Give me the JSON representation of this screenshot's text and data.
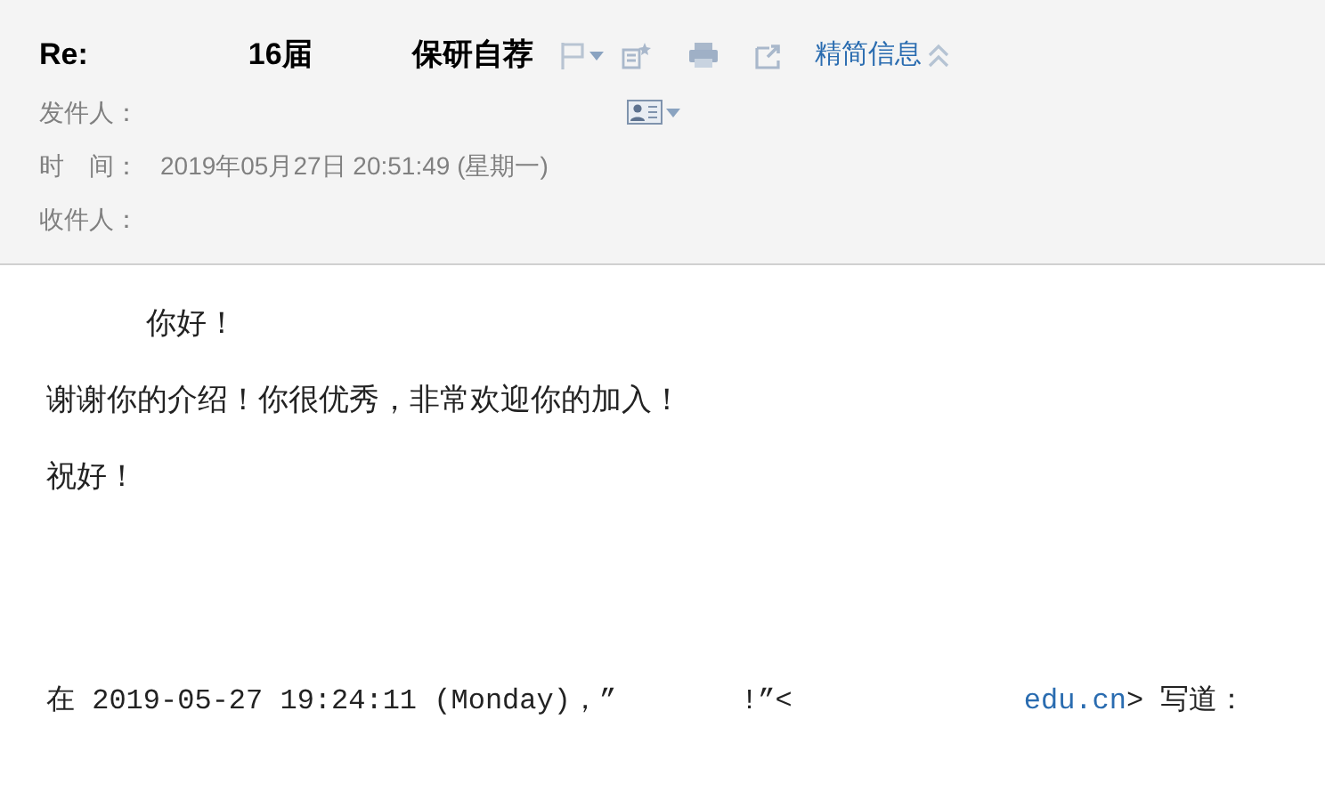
{
  "subject": {
    "parts": [
      "Re:",
      "16届",
      "保研自荐"
    ]
  },
  "toolbar": {
    "toggle_label": "精简信息"
  },
  "fields": [
    {
      "label": "发件人：",
      "kind": "sender"
    },
    {
      "label": "时　间：",
      "kind": "text",
      "value": "2019年05月27日 20:51:49 (星期一)"
    },
    {
      "label": "收件人：",
      "kind": "recipient"
    }
  ],
  "body": [
    {
      "kind": "greeting",
      "text": "你好！"
    },
    {
      "kind": "plain",
      "text": "谢谢你的介绍！你很优秀，非常欢迎你的加入！"
    },
    {
      "kind": "plain",
      "text": "祝好！"
    }
  ],
  "quote": {
    "lead": "在 2019-05-27 19:24:11 (Monday)，”",
    "mid": "!”<",
    "link": "edu.cn",
    "tail": "> 写道："
  }
}
